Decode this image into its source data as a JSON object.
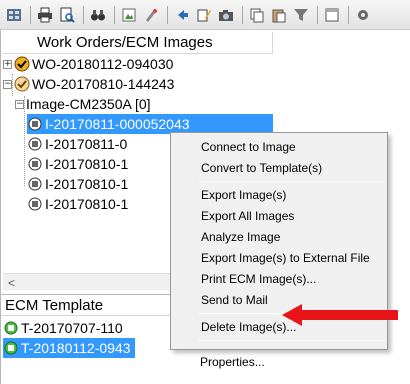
{
  "toolbar": {
    "icons": [
      "grid-icon",
      "print-icon",
      "print-preview-icon",
      "binoculars-icon",
      "image-icon",
      "paint-icon",
      "back-icon",
      "edit-icon",
      "camera-icon",
      "copy-icon",
      "paste-icon",
      "filter-icon",
      "window-icon",
      "gear-icon"
    ]
  },
  "tree": {
    "header": "Work Orders/ECM Images",
    "rows": [
      {
        "label": "WO-20180112-094030"
      },
      {
        "label": "WO-20170810-144243"
      },
      {
        "label": "Image-CM2350A [0]"
      },
      {
        "label": "I-20170811-000052043"
      },
      {
        "label": "I-20170811-0"
      },
      {
        "label": "I-20170810-1"
      },
      {
        "label": "I-20170810-1"
      },
      {
        "label": "I-20170810-1"
      }
    ]
  },
  "ecm": {
    "header": "ECM Template",
    "rows": [
      {
        "label": "T-20170707-110"
      },
      {
        "label": "T-20180112-0943"
      }
    ]
  },
  "context_menu": {
    "items": [
      {
        "label": "Connect to Image"
      },
      {
        "label": "Convert to Template(s)"
      },
      {
        "label": "Export Image(s)"
      },
      {
        "label": "Export All Images"
      },
      {
        "label": "Analyze Image"
      },
      {
        "label": "Export Image(s) to External File"
      },
      {
        "label": "Print ECM Image(s)..."
      },
      {
        "label": "Send to Mail"
      },
      {
        "label": "Delete Image(s)..."
      },
      {
        "label": "Properties..."
      }
    ]
  },
  "colors": {
    "selection": "#3399ff",
    "menu_bg": "#f0f0f0",
    "arrow": "#e8141a"
  }
}
